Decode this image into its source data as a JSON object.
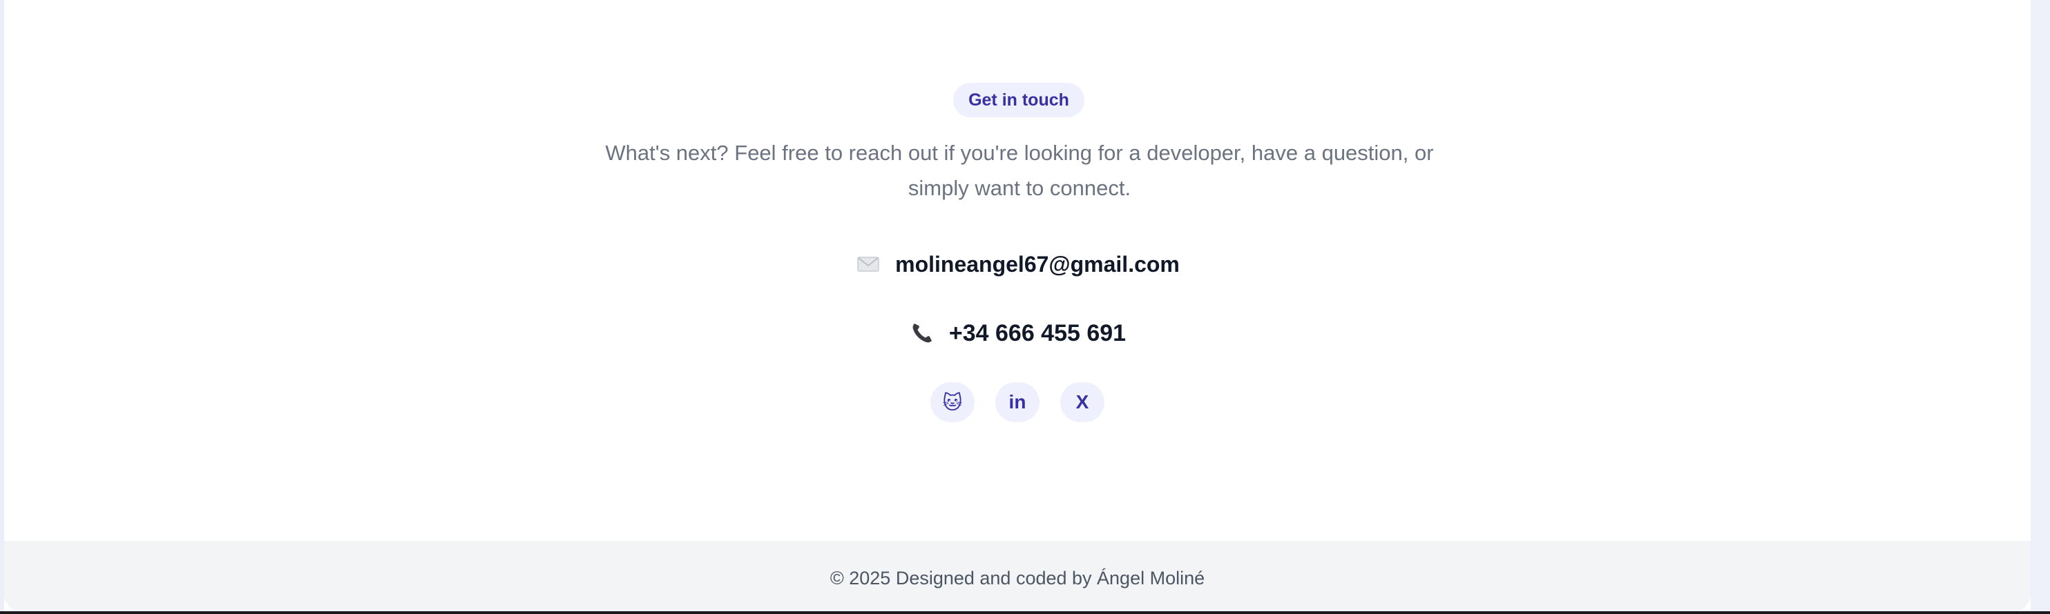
{
  "contact": {
    "badge": "Get in touch",
    "intro": "What's next? Feel free to reach out if you're looking for a developer, have a question, or simply want to connect.",
    "email": "molineangel67@gmail.com",
    "phone": "+34 666 455 691",
    "email_icon": "envelope-icon",
    "phone_icon": "phone-icon"
  },
  "socials": [
    {
      "name": "github",
      "label": "🐱"
    },
    {
      "name": "linkedin",
      "label": "in"
    },
    {
      "name": "x",
      "label": "X"
    }
  ],
  "footer": {
    "text": "© 2025 Designed and coded by Ángel Moliné"
  },
  "colors": {
    "accent": "#3730a3",
    "badge_bg": "#eef0fe",
    "muted_text": "#6b7280",
    "strong_text": "#111827",
    "footer_bg": "#f3f4f6"
  }
}
